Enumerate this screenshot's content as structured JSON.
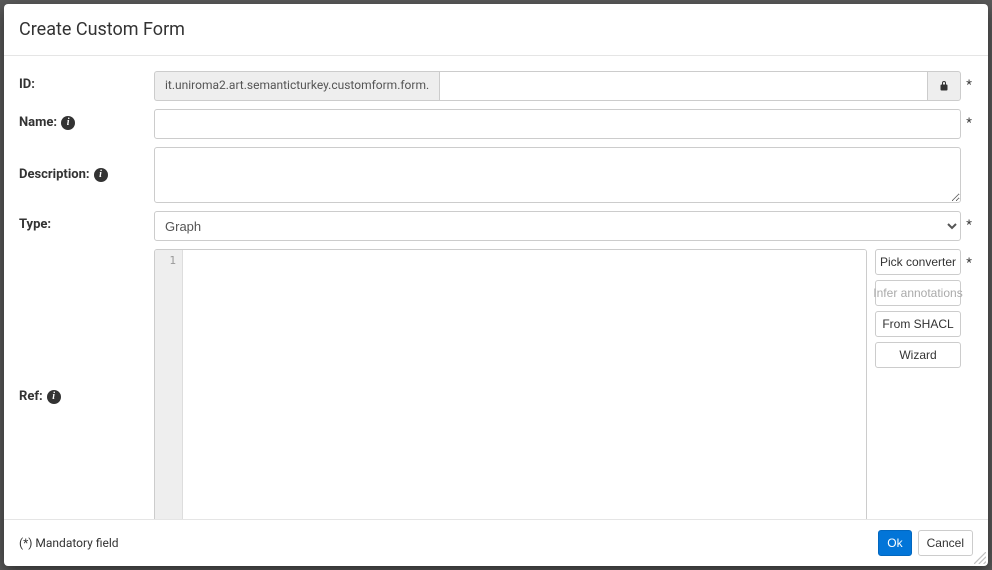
{
  "modal": {
    "title": "Create Custom Form"
  },
  "fields": {
    "id": {
      "label": "ID:",
      "prefix": "it.uniroma2.art.semanticturkey.customform.form.",
      "value": "",
      "required": "*"
    },
    "name": {
      "label": "Name:",
      "value": "",
      "required": "*"
    },
    "description": {
      "label": "Description:",
      "value": ""
    },
    "type": {
      "label": "Type:",
      "selected": "Graph",
      "required": "*"
    },
    "ref": {
      "label": "Ref:",
      "gutter_line": "1",
      "required": "*"
    }
  },
  "side_buttons": {
    "pick_converter": "Pick converter",
    "infer_annotations": "Infer annotations",
    "from_shacl": "From SHACL",
    "wizard": "Wizard"
  },
  "footer": {
    "note": "(*) Mandatory field",
    "ok": "Ok",
    "cancel": "Cancel"
  }
}
